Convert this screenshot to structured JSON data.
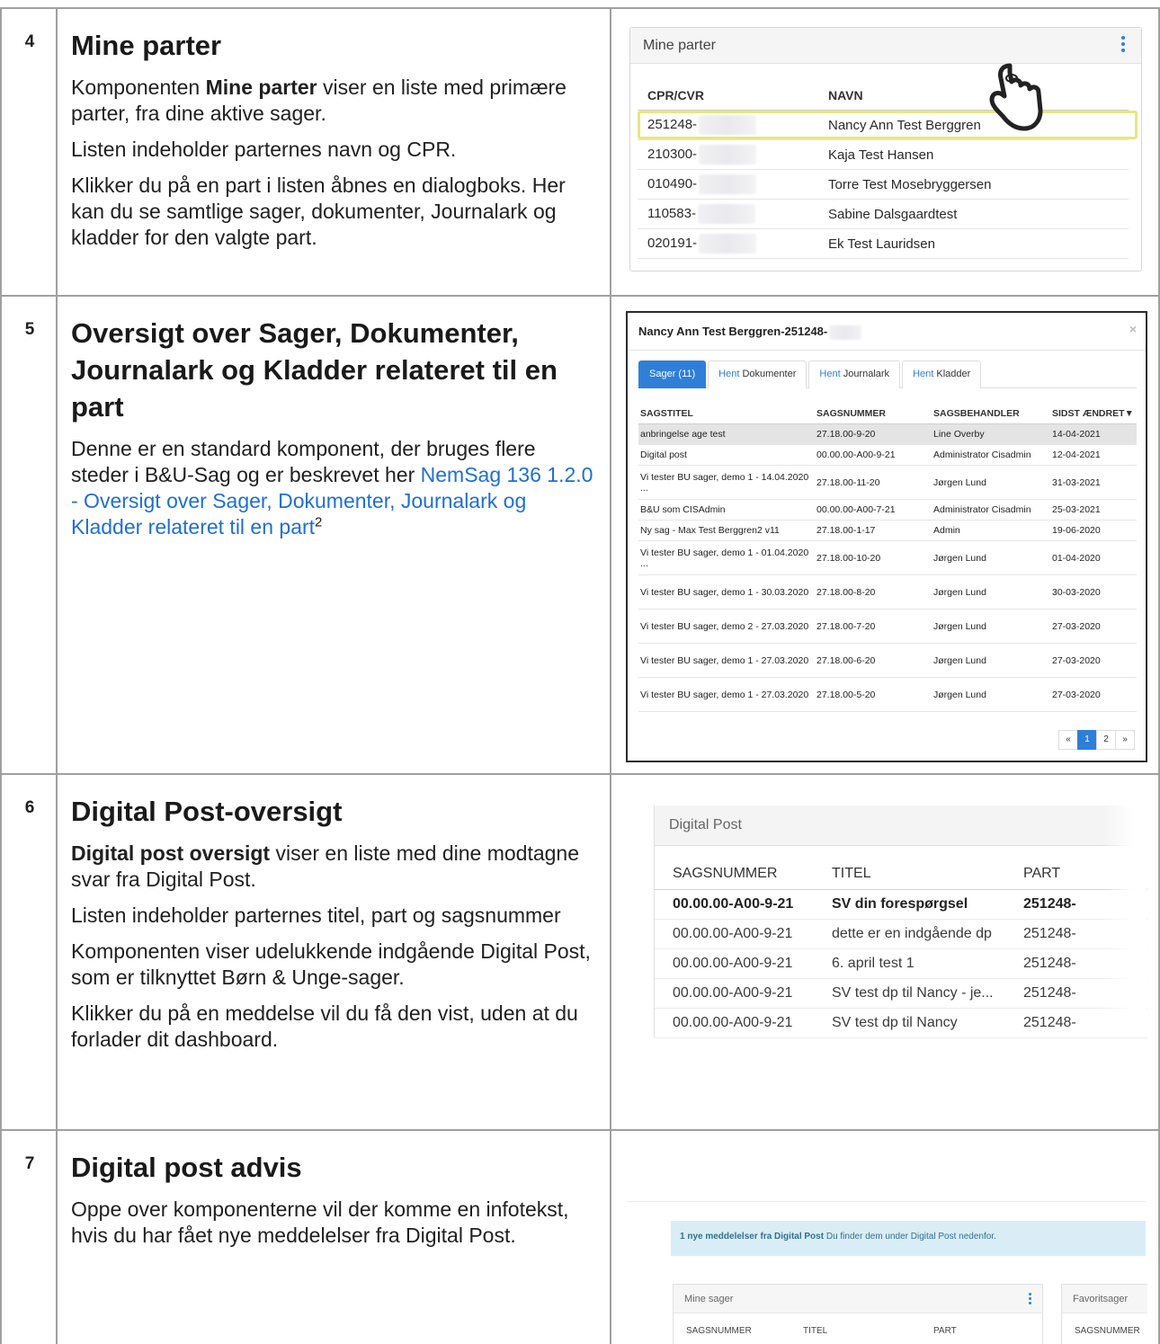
{
  "rows": [
    {
      "num": "4",
      "title": "Mine parter",
      "p1_pre": "Komponenten ",
      "p1_bold": "Mine parter",
      "p1_post": " viser en liste med primære parter, fra dine aktive sager.",
      "p2": "Listen indeholder parternes navn og CPR.",
      "p3": "Klikker du på en part i listen åbnes en dialogboks. Her kan du se samtlige sager, dokumenter, Journalark og kladder for den valgte part."
    },
    {
      "num": "5",
      "title": "Oversigt over Sager, Dokumenter, Journalark og Kladder relateret til en part",
      "p1": "Denne er en standard komponent, der bruges flere steder i B&U-Sag og er beskrevet her",
      "link": "NemSag 136 1.2.0 - Oversigt over Sager, Dokumenter, Journalark og Kladder relateret til en part",
      "sup": "2"
    },
    {
      "num": "6",
      "title": "Digital Post-oversigt",
      "p1_bold": "Digital post oversigt",
      "p1_post": " viser en liste med dine modtagne svar fra Digital Post.",
      "p2": "Listen indeholder parternes titel, part og sagsnummer",
      "p3": "Komponenten viser udelukkende indgående Digital Post, som er tilknyttet Børn & Unge-sager.",
      "p4": "Klikker du på en meddelse vil du få den vist, uden at du forlader dit dashboard."
    },
    {
      "num": "7",
      "title": "Digital post advis",
      "p1": "Oppe over komponenterne vil der komme en infotekst, hvis du har fået nye meddelelser fra Digital Post."
    }
  ],
  "mine_parter": {
    "title": "Mine parter",
    "col1": "CPR/CVR",
    "col2": "NAVN",
    "items": [
      {
        "cpr": "251248-",
        "name": "Nancy Ann Test Berggren"
      },
      {
        "cpr": "210300-",
        "name": "Kaja Test Hansen"
      },
      {
        "cpr": "010490-",
        "name": "Torre Test Mosebryggersen"
      },
      {
        "cpr": "110583-",
        "name": "Sabine Dalsgaardtest"
      },
      {
        "cpr": "020191-",
        "name": "Ek Test Lauridsen"
      }
    ]
  },
  "dialog": {
    "title": "Nancy Ann Test Berggren-251248-",
    "close": "×",
    "tabs": [
      {
        "prefix": "",
        "label": "Sager (11)"
      },
      {
        "prefix": "Hent",
        "label": " Dokumenter"
      },
      {
        "prefix": "Hent",
        "label": " Journalark"
      },
      {
        "prefix": "Hent",
        "label": " Kladder"
      }
    ],
    "headers": [
      "SAGSTITEL",
      "SAGSNUMMER",
      "SAGSBEHANDLER",
      "SIDST ÆNDRET▼"
    ],
    "rows": [
      [
        "anbringelse age test",
        "27.18.00-9-20",
        "Line Overby",
        "14-04-2021"
      ],
      [
        "Digital post",
        "00.00.00-A00-9-21",
        "Administrator Cisadmin",
        "12-04-2021"
      ],
      [
        "Vi tester BU sager, demo 1 - 14.04.2020 ...",
        "27.18.00-11-20",
        "Jørgen Lund",
        "31-03-2021"
      ],
      [
        "B&U som CISAdmin",
        "00.00.00-A00-7-21",
        "Administrator Cisadmin",
        "25-03-2021"
      ],
      [
        "Ny sag - Max Test Berggren2 v11",
        "27.18.00-1-17",
        "Admin",
        "19-06-2020"
      ],
      [
        "Vi tester BU sager, demo 1 - 01.04.2020 ...",
        "27.18.00-10-20",
        "Jørgen Lund",
        "01-04-2020"
      ],
      [
        "Vi tester BU sager, demo 1 - 30.03.2020",
        "27.18.00-8-20",
        "Jørgen Lund",
        "30-03-2020"
      ],
      [
        "Vi tester BU sager, demo 2 - 27.03.2020",
        "27.18.00-7-20",
        "Jørgen Lund",
        "27-03-2020"
      ],
      [
        "Vi tester BU sager, demo 1 - 27.03.2020",
        "27.18.00-6-20",
        "Jørgen Lund",
        "27-03-2020"
      ],
      [
        "Vi tester BU sager, demo 1 - 27.03.2020",
        "27.18.00-5-20",
        "Jørgen Lund",
        "27-03-2020"
      ]
    ],
    "pager": [
      "«",
      "1",
      "2",
      "»"
    ]
  },
  "digital_post": {
    "title": "Digital Post",
    "headers": [
      "SAGSNUMMER",
      "TITEL",
      "PART"
    ],
    "rows": [
      [
        "00.00.00-A00-9-21",
        "SV din forespørgsel",
        "251248-"
      ],
      [
        "00.00.00-A00-9-21",
        "dette er en indgående dp",
        "251248-"
      ],
      [
        "00.00.00-A00-9-21",
        "6. april test 1",
        "251248-"
      ],
      [
        "00.00.00-A00-9-21",
        "SV test dp til Nancy - je...",
        "251248-"
      ],
      [
        "00.00.00-A00-9-21",
        "SV test dp til Nancy",
        "251248-"
      ]
    ]
  },
  "advis": {
    "info_bold": "1 nye meddelelser fra Digital Post",
    "info_rest": " Du finder dem under Digital Post nedenfor.",
    "box1_title": "Mine sager",
    "box1_cols": [
      "SAGSNUMMER",
      "TITEL",
      "PART"
    ],
    "box2_title": "Favoritsager",
    "box2_col": "SAGSNUMMER"
  },
  "colors": {
    "link": "#1f6fd1",
    "accent": "#2f7fd8",
    "highlight": "#e8e67e",
    "info_bg": "#d9edf7"
  }
}
